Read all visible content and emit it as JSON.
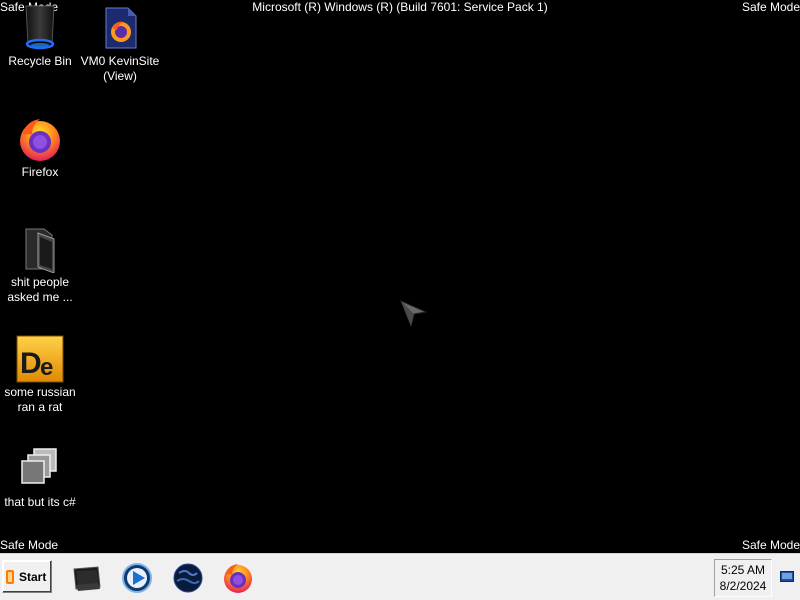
{
  "overlay": {
    "safe_mode_label": "Safe Mode",
    "build_string": "Microsoft (R) Windows (R) (Build 7601: Service Pack 1)"
  },
  "desktop_icons": [
    {
      "label": "Recycle Bin",
      "icon": "recycle-bin-icon"
    },
    {
      "label": "VM0 KevinSite\n(View)",
      "icon": "firefox-shortcut-icon"
    },
    {
      "label": "Firefox",
      "icon": "firefox-icon"
    },
    {
      "label": "shit people\nasked me ...",
      "icon": "folder-icon"
    },
    {
      "label": "some russian\nran a rat",
      "icon": "dreamweaver-icon"
    },
    {
      "label": "that but its c#",
      "icon": "windows-stack-icon"
    }
  ],
  "taskbar": {
    "start_label": "Start",
    "pinned": [
      {
        "name": "explorer-icon"
      },
      {
        "name": "media-player-icon"
      },
      {
        "name": "globe-icon"
      },
      {
        "name": "firefox-icon"
      }
    ],
    "clock": {
      "time": "5:25 AM",
      "date": "8/2/2024"
    }
  },
  "colors": {
    "desktop_bg": "#000000",
    "taskbar_bg": "#f0f0f0",
    "text": "#ffffff"
  }
}
